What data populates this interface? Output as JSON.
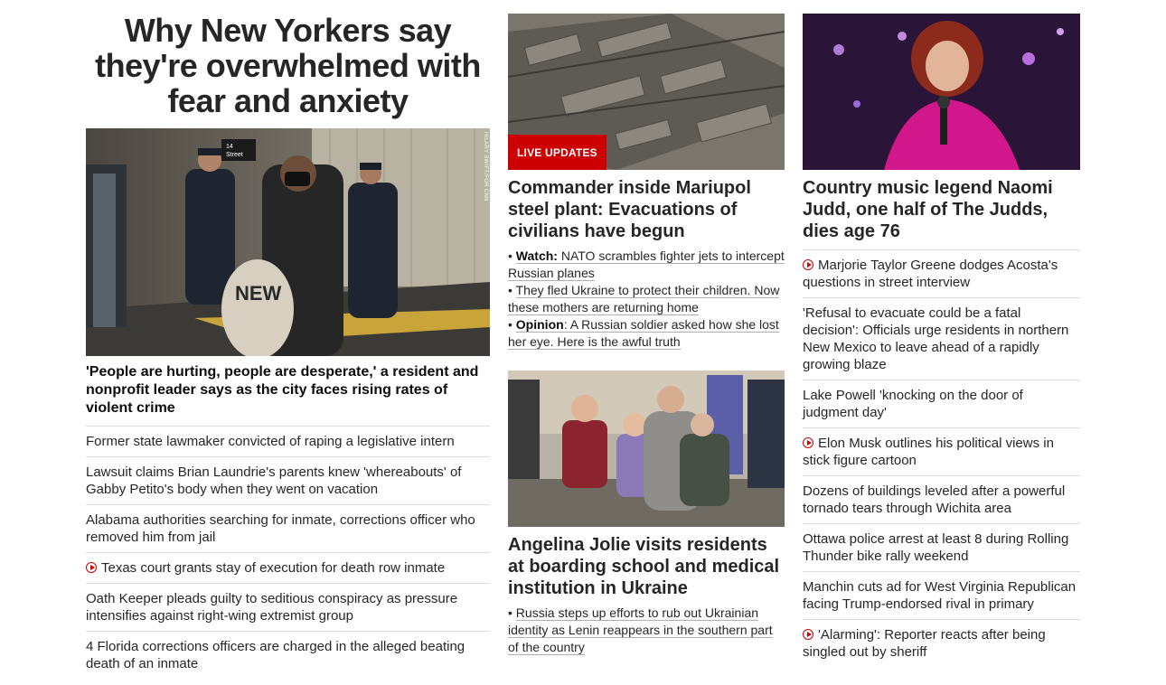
{
  "col1": {
    "title": "Why New Yorkers say they're overwhelmed with fear and anxiety",
    "photo_credit": "HILARY SWIFT/FOR CNN",
    "station_sign": "14 Street",
    "lead": "'People are hurting, people are desperate,' a resident and nonprofit leader says as the city faces rising rates of violent crime",
    "items": [
      {
        "text": "Former state lawmaker convicted of raping a legislative intern",
        "video": false
      },
      {
        "text": "Lawsuit claims Brian Laundrie's parents knew 'whereabouts' of Gabby Petito's body when they went on vacation",
        "video": false
      },
      {
        "text": "Alabama authorities searching for inmate, corrections officer who removed him from jail",
        "video": false
      },
      {
        "text": "Texas court grants stay of execution for death row inmate",
        "video": true
      },
      {
        "text": "Oath Keeper pleads guilty to seditious conspiracy as pressure intensifies against right-wing extremist group",
        "video": false
      },
      {
        "text": "4 Florida corrections officers are charged in the alleged beating death of an inmate",
        "video": false
      }
    ]
  },
  "col2": {
    "story1": {
      "badge": "LIVE UPDATES",
      "headline": "Commander inside Mariupol steel plant: Evacuations of civilians have begun",
      "subs": [
        {
          "bullet": "•",
          "label": "Watch:",
          "text": "NATO scrambles fighter jets to intercept Russian planes"
        },
        {
          "bullet": "•",
          "label": "",
          "text": "They fled Ukraine to protect their children. Now these mothers are returning home"
        },
        {
          "bullet": "•",
          "label": "Opinion",
          "text": ": A Russian soldier asked how she lost her eye. Here is the awful truth"
        }
      ]
    },
    "story2": {
      "headline": "Angelina Jolie visits residents at boarding school and medical institution in Ukraine",
      "subs": [
        {
          "bullet": "•",
          "label": "",
          "text": "Russia steps up efforts to rub out Ukrainian identity as Lenin reappears in the southern part of the country"
        }
      ]
    }
  },
  "col3": {
    "headline": "Country music legend Naomi Judd, one half of The Judds, dies age 76",
    "items": [
      {
        "text": "Marjorie Taylor Greene dodges Acosta's questions in street interview",
        "video": true
      },
      {
        "text": "'Refusal to evacuate could be a fatal decision': Officials urge residents in northern New Mexico to leave ahead of a rapidly growing blaze",
        "video": false
      },
      {
        "text": "Lake Powell 'knocking on the door of judgment day'",
        "video": false
      },
      {
        "text": "Elon Musk outlines his political views in stick figure cartoon",
        "video": true
      },
      {
        "text": "Dozens of buildings leveled after a powerful tornado tears through Wichita area",
        "video": false
      },
      {
        "text": "Ottawa police arrest at least 8 during Rolling Thunder bike rally weekend",
        "video": false
      },
      {
        "text": "Manchin cuts ad for West Virginia Republican facing Trump-endorsed rival in primary",
        "video": false
      },
      {
        "text": "'Alarming': Reporter reacts after being singled out by sheriff",
        "video": true
      }
    ]
  }
}
